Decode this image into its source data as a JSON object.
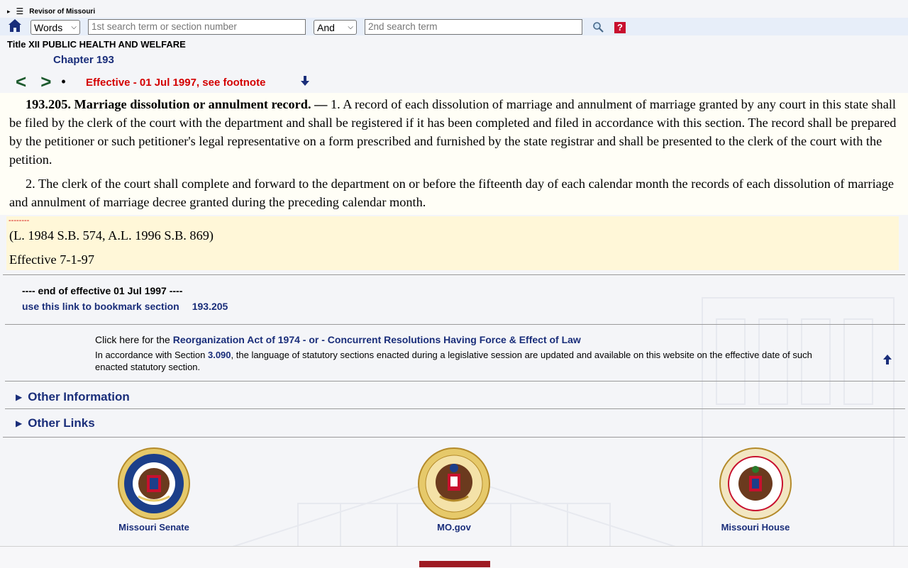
{
  "header": {
    "site_title": "Revisor of Missouri",
    "expand_glyph": "▸",
    "menu_glyph": "☰"
  },
  "search": {
    "mode_value": "Words",
    "term1_placeholder": "1st search term or section number",
    "connector_value": "And",
    "term2_placeholder": "2nd search term",
    "help_label": "?"
  },
  "breadcrumb": {
    "title": "Title XII PUBLIC HEALTH AND WELFARE",
    "chapter": "Chapter 193"
  },
  "nav": {
    "prev": "<",
    "next": ">",
    "bullet": "•",
    "effective_note": "Effective - 01 Jul 1997, see footnote"
  },
  "statute": {
    "section_heading": "193.205.  Marriage dissolution or annulment record. —",
    "para1_body": " 1.  A record of each dissolution of marriage and annulment of marriage granted by any court in this state shall be filed by the clerk of the court with the department and shall be registered if it has been completed and filed in accordance with this section.  The record shall be prepared by the petitioner or such petitioner's legal representative on a form prescribed and furnished by the state registrar and shall be presented to the clerk of the court with the petition.",
    "para2": "2.  The clerk of the court shall complete and forward to the department on or before the fifteenth day of each calendar month the records of each dissolution of marriage and annulment of marriage decree granted during the preceding calendar month."
  },
  "footnote": {
    "dashes": "--------",
    "history": "(L. 1984 S.B. 574, A.L. 1996 S.B. 869)",
    "effective": "Effective 7-1-97"
  },
  "end_block": {
    "end_text": "---- end of effective    01 Jul 1997 ----",
    "bookmark_label": "use this link to bookmark section",
    "bookmark_section": "193.205"
  },
  "notice": {
    "click_prefix": "Click here for the ",
    "reorg_link": "Reorganization Act of 1974 - or - Concurrent Resolutions Having Force & Effect of Law",
    "accord_prefix": "In accordance with Section ",
    "accord_link": "3.090",
    "accord_suffix": ", the language of statutory sections enacted during a legislative session are updated and available on this website on the effective date of such enacted statutory section."
  },
  "sections": {
    "other_info": "Other Information",
    "other_links": "Other Links"
  },
  "footer": {
    "senate_label": "Missouri Senate",
    "mogov_label": "MO.gov",
    "house_label": "Missouri House",
    "senate_seal_text": "MISSOURI SENATE",
    "state_seal_text": "THE GREAT SEAL OF THE STATE OF MISSOURI",
    "house_seal_text": "MISSOURI HOUSE OF REPRESENTATIVES"
  },
  "colors": {
    "link_blue": "#1a2e7a",
    "effective_red": "#d40000",
    "nav_green": "#1d5a2e",
    "footnote_bg": "#fff7d8"
  },
  "icons": [
    "home-icon",
    "search-icon",
    "help-icon",
    "down-arrow-icon",
    "up-arrow-icon",
    "chevron-right-icon"
  ]
}
